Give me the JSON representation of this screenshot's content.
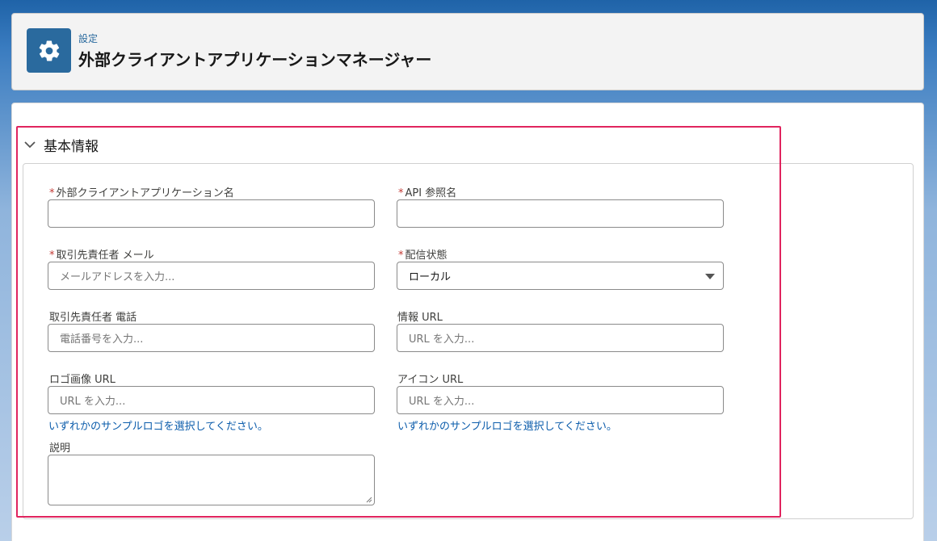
{
  "header": {
    "eyebrow": "設定",
    "title": "外部クライアントアプリケーションマネージャー",
    "icon": "gear-icon"
  },
  "section": {
    "title": "基本情報",
    "collapse_icon": "chevron-down-icon"
  },
  "form": {
    "app_name": {
      "label": "外部クライアントアプリケーション名",
      "required": "*",
      "value": "",
      "placeholder": ""
    },
    "api_name": {
      "label": "API 参照名",
      "required": "*",
      "value": "",
      "placeholder": ""
    },
    "contact_email": {
      "label": "取引先責任者 メール",
      "required": "*",
      "placeholder": "メールアドレスを入力..."
    },
    "distribution_state": {
      "label": "配信状態",
      "required": "*",
      "value": "ローカル"
    },
    "contact_phone": {
      "label": "取引先責任者 電話",
      "placeholder": "電話番号を入力..."
    },
    "info_url": {
      "label": "情報 URL",
      "placeholder": "URL を入力..."
    },
    "logo_url": {
      "label": "ロゴ画像 URL",
      "placeholder": "URL を入力...",
      "link": "いずれかのサンプルロゴを選択してください。"
    },
    "icon_url": {
      "label": "アイコン URL",
      "placeholder": "URL を入力...",
      "link": "いずれかのサンプルロゴを選択してください。"
    },
    "description": {
      "label": "説明",
      "value": ""
    }
  },
  "colors": {
    "accent": "#2a6a9e",
    "link": "#0b5cab",
    "required": "#c23934",
    "highlight": "#e0245e"
  }
}
